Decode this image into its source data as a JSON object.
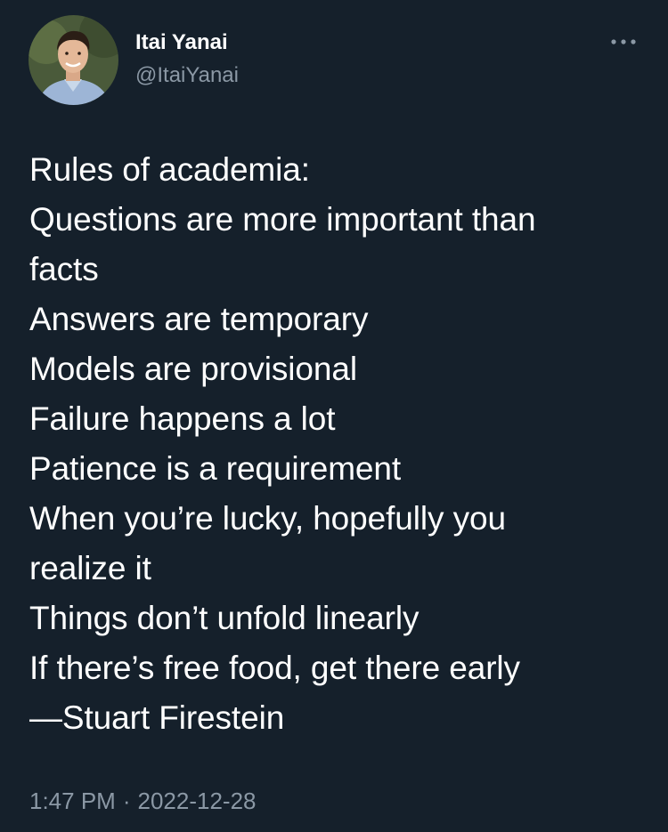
{
  "author": {
    "display_name": "Itai Yanai",
    "handle": "@ItaiYanai",
    "avatar_icon": "profile-photo"
  },
  "more_icon": "ellipsis-icon",
  "tweet": {
    "lines": [
      "Rules of academia:",
      "Questions are more important than",
      "facts",
      "Answers are temporary",
      "Models are provisional",
      "Failure happens a lot",
      "Patience is a requirement",
      "When you’re lucky, hopefully you",
      "realize it",
      "Things don’t unfold linearly",
      "If there’s free food, get there early",
      "—Stuart Firestein"
    ]
  },
  "meta": {
    "time": "1:47 PM",
    "separator": "·",
    "date": "2022-12-28"
  },
  "colors": {
    "background": "#15202b",
    "primary_text": "#ffffff",
    "secondary_text": "#8b98a5"
  }
}
